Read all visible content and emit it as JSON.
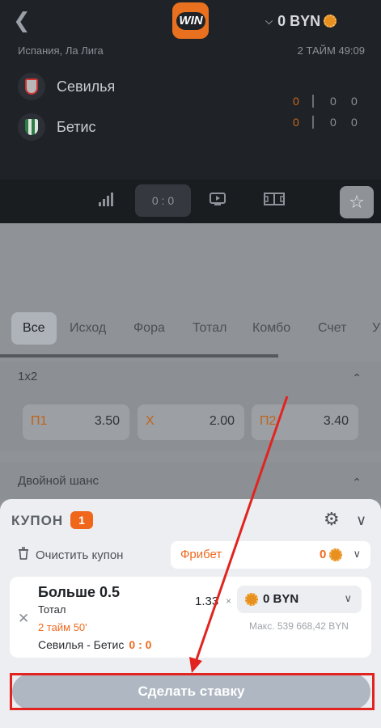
{
  "header": {
    "back_icon": "chevron-left-icon",
    "logo_text": "WIN",
    "balance": "0 BYN",
    "league": "Испания, Ла Лига",
    "period": "2 ТАЙМ 49:09",
    "teams": [
      {
        "name": "Севилья",
        "scores": [
          "0",
          "0",
          "0"
        ]
      },
      {
        "name": "Бетис",
        "scores": [
          "0",
          "0",
          "0"
        ]
      }
    ],
    "score_tab": "0 : 0"
  },
  "market_tabs": [
    "Все",
    "Исход",
    "Фора",
    "Тотал",
    "Комбо",
    "Счет",
    "У"
  ],
  "sections": {
    "one_x_two": {
      "title": "1x2",
      "odds": [
        {
          "label": "П1",
          "value": "3.50"
        },
        {
          "label": "Х",
          "value": "2.00"
        },
        {
          "label": "П2",
          "value": "3.40"
        }
      ]
    },
    "double_chance": {
      "title": "Двойной шанс"
    }
  },
  "coupon": {
    "title": "КУПОН",
    "count": "1",
    "clear_label": "Очистить купон",
    "freebet_label": "Фрибет",
    "freebet_value": "0",
    "bet": {
      "title": "Больше 0.5",
      "type": "Тотал",
      "time": "2 тайм 50'",
      "match": "Севилья - Бетис",
      "score": "0 : 0",
      "odd": "1.33",
      "mult": "×",
      "stake": "0 BYN",
      "max": "Макс. 539 668,42 BYN"
    },
    "place_button": "Сделать ставку"
  },
  "colors": {
    "accent": "#ef6a1f",
    "highlight": "#e1241f",
    "button": "#aeb7c2"
  }
}
